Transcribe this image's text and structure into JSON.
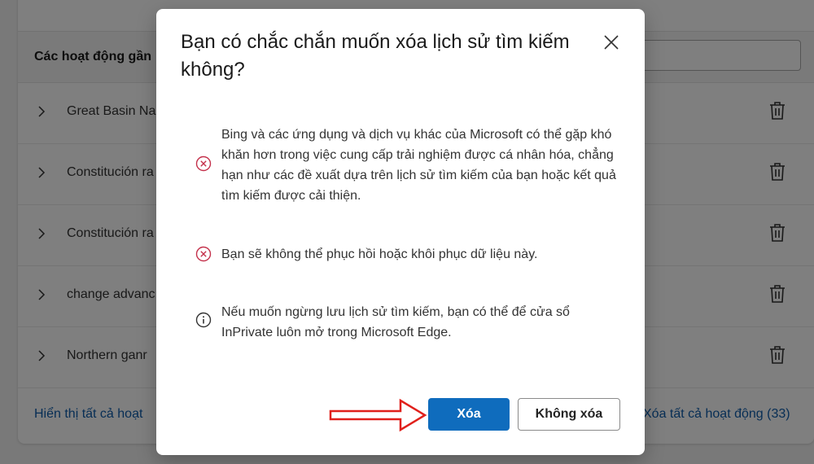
{
  "background": {
    "section_title": "Các hoạt động gần",
    "rows": [
      {
        "label": "Great Basin Na"
      },
      {
        "label": "Constitución ra"
      },
      {
        "label": "Constitución ra"
      },
      {
        "label": "change advanc"
      },
      {
        "label": "Northern ganr"
      }
    ],
    "footer_left_link": "Hiển thị tất cả hoạt",
    "footer_right_link": "Xóa tất cả hoạt động (33)"
  },
  "dialog": {
    "title": "Bạn có chắc chắn muốn xóa lịch sử tìm kiếm không?",
    "items": [
      {
        "icon": "error-circle-icon",
        "text": "Bing và các ứng dụng và dịch vụ khác của Microsoft có thể gặp khó khăn hơn trong việc cung cấp trải nghiệm được cá nhân hóa, chẳng hạn như các đề xuất dựa trên lịch sử tìm kiếm của bạn hoặc kết quả tìm kiếm được cải thiện."
      },
      {
        "icon": "error-circle-icon",
        "text": "Bạn sẽ không thể phục hồi hoặc khôi phục dữ liệu này."
      },
      {
        "icon": "info-circle-icon",
        "text": "Nếu muốn ngừng lưu lịch sử tìm kiếm, bạn có thể để cửa sổ InPrivate luôn mở trong Microsoft Edge."
      }
    ],
    "confirm_label": "Xóa",
    "cancel_label": "Không xóa"
  },
  "colors": {
    "primary": "#0f6cbd",
    "error_icon": "#c4314b",
    "link": "#0f5cab",
    "annotation_arrow": "#e0201b"
  }
}
